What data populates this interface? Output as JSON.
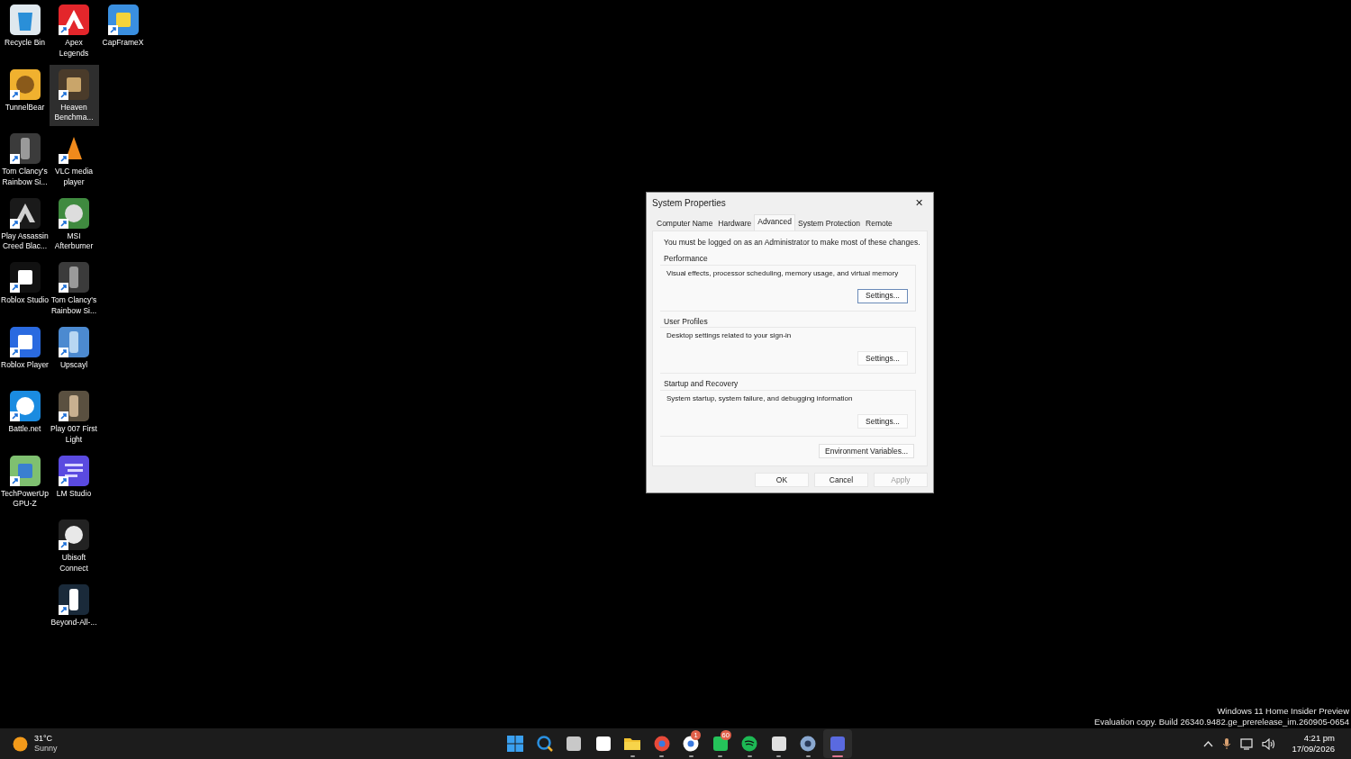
{
  "desktop_icons": [
    {
      "label": "Recycle Bin",
      "shortcut": false,
      "selected": false
    },
    {
      "label": "Apex Legends",
      "shortcut": true,
      "selected": false
    },
    {
      "label": "CapFrameX",
      "shortcut": true,
      "selected": false
    },
    {
      "label": "TunnelBear",
      "shortcut": true,
      "selected": false
    },
    {
      "label": "Heaven Benchma...",
      "shortcut": true,
      "selected": true
    },
    {
      "label": "Tom Clancy's Rainbow Si...",
      "shortcut": true,
      "selected": false
    },
    {
      "label": "VLC media player",
      "shortcut": true,
      "selected": false
    },
    {
      "label": "Play Assassin Creed Blac...",
      "shortcut": true,
      "selected": false
    },
    {
      "label": "MSI Afterburner",
      "shortcut": true,
      "selected": false
    },
    {
      "label": "Roblox Studio",
      "shortcut": true,
      "selected": false
    },
    {
      "label": "Tom Clancy's Rainbow Si...",
      "shortcut": true,
      "selected": false
    },
    {
      "label": "Roblox Player",
      "shortcut": true,
      "selected": false
    },
    {
      "label": "Upscayl",
      "shortcut": true,
      "selected": false
    },
    {
      "label": "Battle.net",
      "shortcut": true,
      "selected": false
    },
    {
      "label": "Play 007 First Light",
      "shortcut": true,
      "selected": false
    },
    {
      "label": "TechPowerUp GPU-Z",
      "shortcut": true,
      "selected": false
    },
    {
      "label": "LM Studio",
      "shortcut": true,
      "selected": false
    },
    {
      "label": "Ubisoft Connect",
      "shortcut": true,
      "selected": false
    },
    {
      "label": "Beyond-All-...",
      "shortcut": true,
      "selected": false
    }
  ],
  "dialog": {
    "title": "System Properties",
    "close": "✕",
    "tabs": [
      {
        "label": "Computer Name",
        "selected": false
      },
      {
        "label": "Hardware",
        "selected": false
      },
      {
        "label": "Advanced",
        "selected": true
      },
      {
        "label": "System Protection",
        "selected": false
      },
      {
        "label": "Remote",
        "selected": false
      }
    ],
    "notice": "You must be logged on as an Administrator to make most of these changes.",
    "groups": [
      {
        "title": "Performance",
        "description": "Visual effects, processor scheduling, memory usage, and virtual memory",
        "button": "Settings...",
        "focused": true
      },
      {
        "title": "User Profiles",
        "description": "Desktop settings related to your sign-in",
        "button": "Settings...",
        "focused": false
      },
      {
        "title": "Startup and Recovery",
        "description": "System startup, system failure, and debugging information",
        "button": "Settings...",
        "focused": false
      }
    ],
    "env_button": "Environment Variables...",
    "buttons": [
      {
        "label": "OK",
        "disabled": false
      },
      {
        "label": "Cancel",
        "disabled": false
      },
      {
        "label": "Apply",
        "disabled": true
      }
    ]
  },
  "watermark": {
    "line_1": "Windows 11 Home Insider Preview",
    "line_2": "Evaluation copy. Build 26340.9482.ge_prerelease_im.260905-0654"
  },
  "taskbar": {
    "weather": {
      "temperature": "31°C",
      "condition": "Sunny"
    },
    "apps": [
      {
        "running": false,
        "active": false
      },
      {
        "running": false,
        "active": false
      },
      {
        "running": false,
        "active": false
      },
      {
        "running": false,
        "active": false
      },
      {
        "running": true,
        "active": false
      },
      {
        "running": true,
        "active": false
      },
      {
        "running": true,
        "active": false,
        "badge": "1"
      },
      {
        "running": true,
        "active": false,
        "badge": "60"
      },
      {
        "running": true,
        "active": false
      },
      {
        "running": true,
        "active": false
      },
      {
        "running": true,
        "active": false
      },
      {
        "running": true,
        "active": true
      }
    ],
    "time": "4:21 pm",
    "date": "17/09/2026"
  }
}
